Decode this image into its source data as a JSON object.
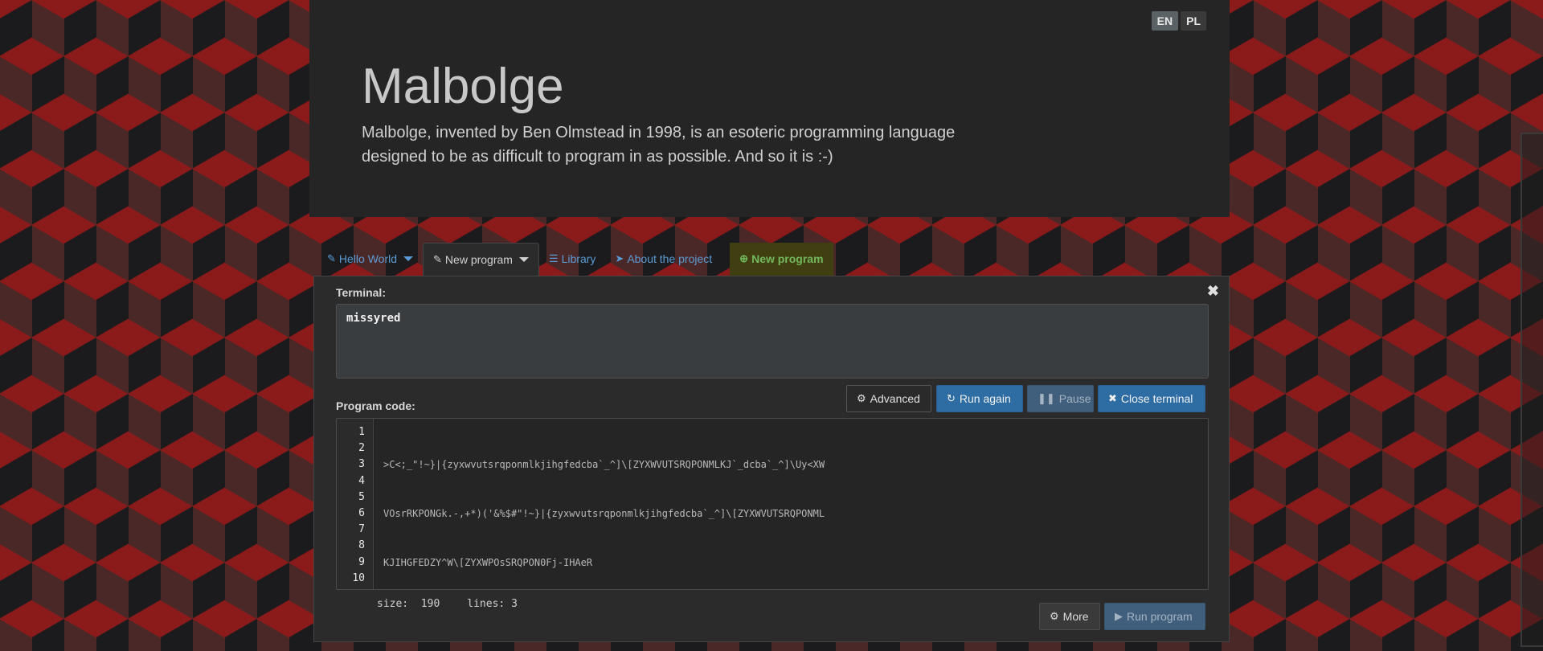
{
  "lang": {
    "en": "EN",
    "pl": "PL"
  },
  "header": {
    "title": "Malbolge",
    "subtitle": "Malbolge, invented by Ben Olmstead in 1998, is an esoteric programming language designed to be as difficult to program in as possible. And so it is :-)"
  },
  "tabs": [
    {
      "label": "Hello World",
      "icon": "edit-icon"
    },
    {
      "label": "New program",
      "icon": "edit-icon"
    },
    {
      "label": "Library",
      "icon": "list-icon"
    },
    {
      "label": "About the project",
      "icon": "send-icon"
    },
    {
      "label": "New program",
      "icon": "plus-circle-icon"
    }
  ],
  "terminal": {
    "label": "Terminal:",
    "output": "missyred"
  },
  "buttons": {
    "advanced": "Advanced",
    "run_again": "Run again",
    "pause": "Pause",
    "close_terminal": "Close terminal",
    "more": "More",
    "run_program": "Run program"
  },
  "editor": {
    "label": "Program code:",
    "line_numbers": [
      "1",
      "2",
      "3",
      "4",
      "5",
      "6",
      "7",
      "8",
      "9",
      "10"
    ],
    "lines": [
      ">C<;_\"!~}|{zyxwvutsrqponmlkjihgfedcba`_^]\\[ZYXWVUTSRQPONMLKJ`_dcba`_^]\\Uy<XW",
      "VOsrRKPONGk.-,+*)('&%$#\"!~}|{zyxwvutsrqponmlkjihgfedcba`_^]\\[ZYXWVUTSRQPONML",
      "KJIHGFEDZY^W\\[ZYXWPOsSRQPON0Fj-IHAeR"
    ]
  },
  "stats": {
    "size_label": "size:",
    "size_value": "190",
    "lines_label": "lines:",
    "lines_value": "3"
  },
  "colors": {
    "accent": "#2e6da4",
    "link": "#5b9bd5",
    "highlight_tab": "#3f3f12"
  }
}
